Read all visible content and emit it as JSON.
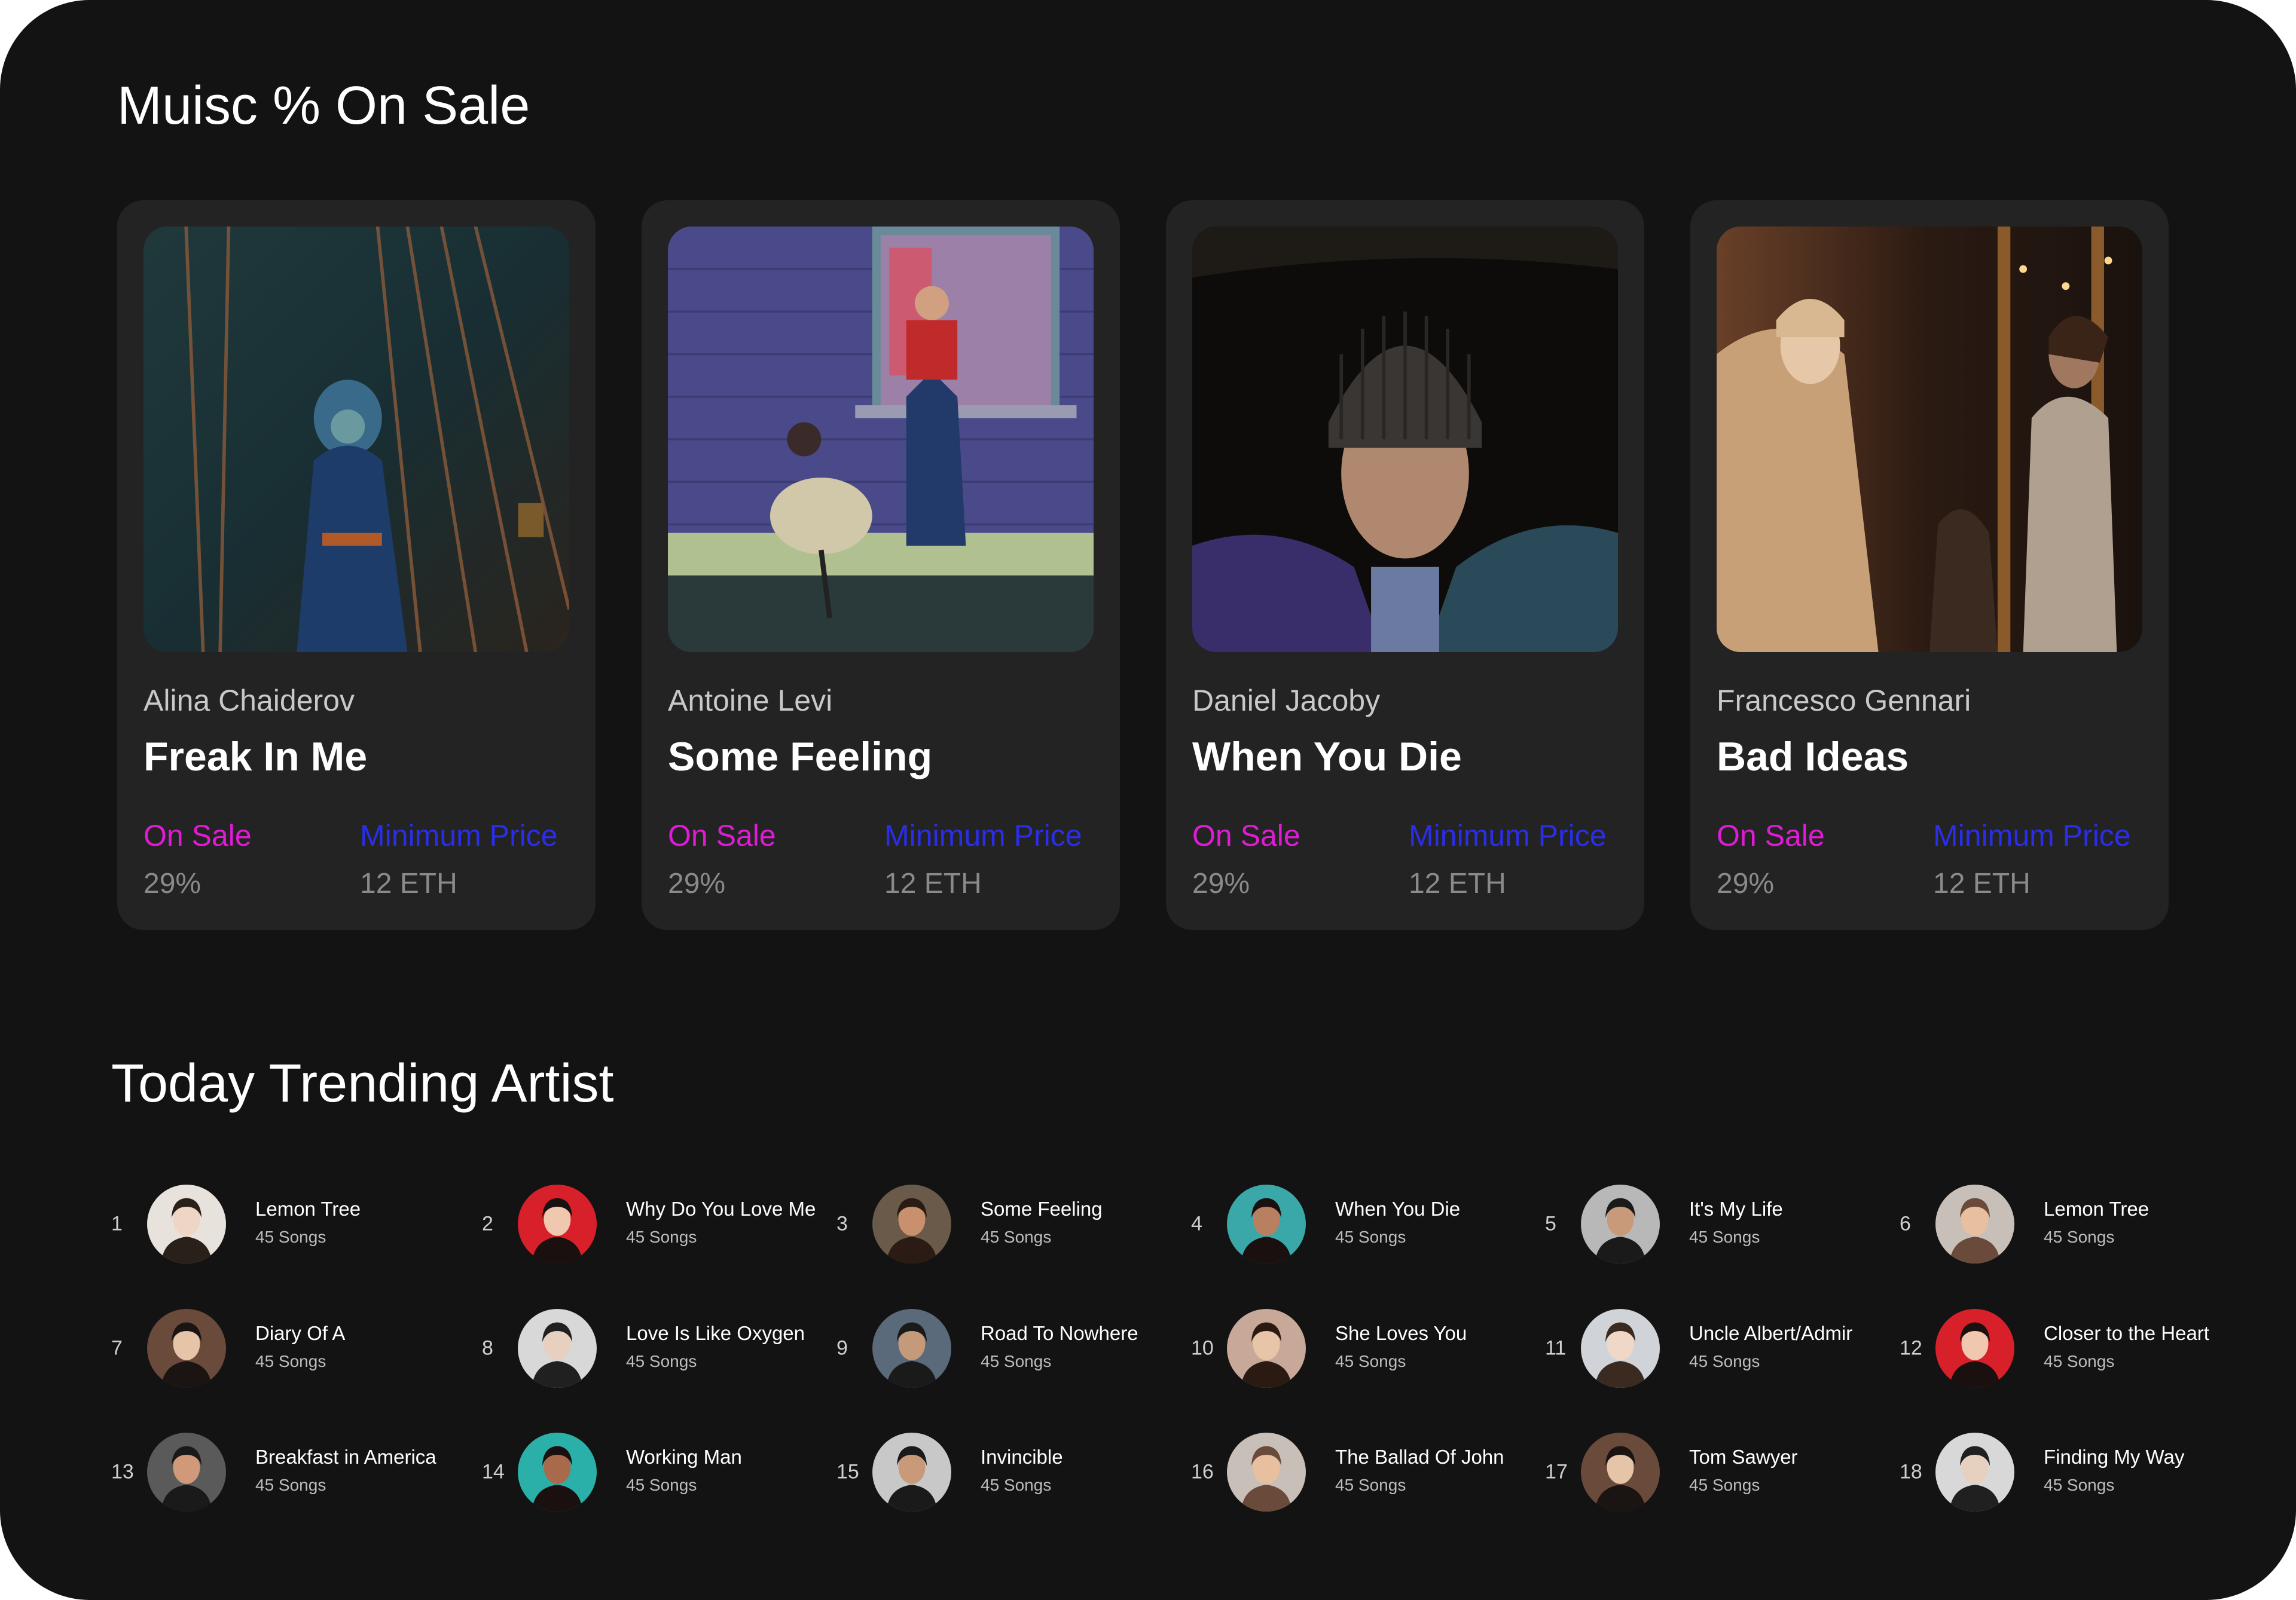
{
  "sale_section": {
    "title": "Muisc % On Sale",
    "cards": [
      {
        "artist": "Alina Chaiderov",
        "song": "Freak In Me",
        "sale_label": "On Sale",
        "sale_value": "29%",
        "price_label": "Minimum Price",
        "price_value": "12 ETH"
      },
      {
        "artist": "Antoine Levi",
        "song": "Some Feeling",
        "sale_label": "On Sale",
        "sale_value": "29%",
        "price_label": "Minimum Price",
        "price_value": "12 ETH"
      },
      {
        "artist": "Daniel Jacoby",
        "song": "When You Die",
        "sale_label": "On Sale",
        "sale_value": "29%",
        "price_label": "Minimum Price",
        "price_value": "12 ETH"
      },
      {
        "artist": "Francesco Gennari",
        "song": "Bad Ideas",
        "sale_label": "On Sale",
        "sale_value": "29%",
        "price_label": "Minimum Price",
        "price_value": "12 ETH"
      }
    ]
  },
  "trending_section": {
    "title": "Today Trending Artist",
    "artists": [
      {
        "rank": "1",
        "name": "Lemon Tree",
        "songs": "45 Songs"
      },
      {
        "rank": "2",
        "name": "Why Do You Love Me",
        "songs": "45 Songs"
      },
      {
        "rank": "3",
        "name": "Some Feeling",
        "songs": "45 Songs"
      },
      {
        "rank": "4",
        "name": "When You Die",
        "songs": "45 Songs"
      },
      {
        "rank": "5",
        "name": "It's My Life",
        "songs": "45 Songs"
      },
      {
        "rank": "6",
        "name": "Lemon Tree",
        "songs": "45 Songs"
      },
      {
        "rank": "7",
        "name": "Diary Of A",
        "songs": "45 Songs"
      },
      {
        "rank": "8",
        "name": "Love Is Like Oxygen",
        "songs": "45 Songs"
      },
      {
        "rank": "9",
        "name": "Road To Nowhere",
        "songs": "45 Songs"
      },
      {
        "rank": "10",
        "name": "She Loves You",
        "songs": "45 Songs"
      },
      {
        "rank": "11",
        "name": "Uncle Albert/Admir",
        "songs": "45 Songs"
      },
      {
        "rank": "12",
        "name": "Closer to the Heart",
        "songs": "45 Songs"
      },
      {
        "rank": "13",
        "name": "Breakfast in America",
        "songs": "45 Songs"
      },
      {
        "rank": "14",
        "name": "Working Man",
        "songs": "45 Songs"
      },
      {
        "rank": "15",
        "name": "Invincible",
        "songs": "45 Songs"
      },
      {
        "rank": "16",
        "name": "The Ballad Of John",
        "songs": "45 Songs"
      },
      {
        "rank": "17",
        "name": "Tom Sawyer",
        "songs": "45 Songs"
      },
      {
        "rank": "18",
        "name": "Finding My Way",
        "songs": "45 Songs"
      }
    ]
  },
  "colors": {
    "background": "#131313",
    "card": "#232323",
    "on_sale": "#e01bd6",
    "minimum_price": "#2a2ee8",
    "muted_value": "#8a8a8a"
  }
}
